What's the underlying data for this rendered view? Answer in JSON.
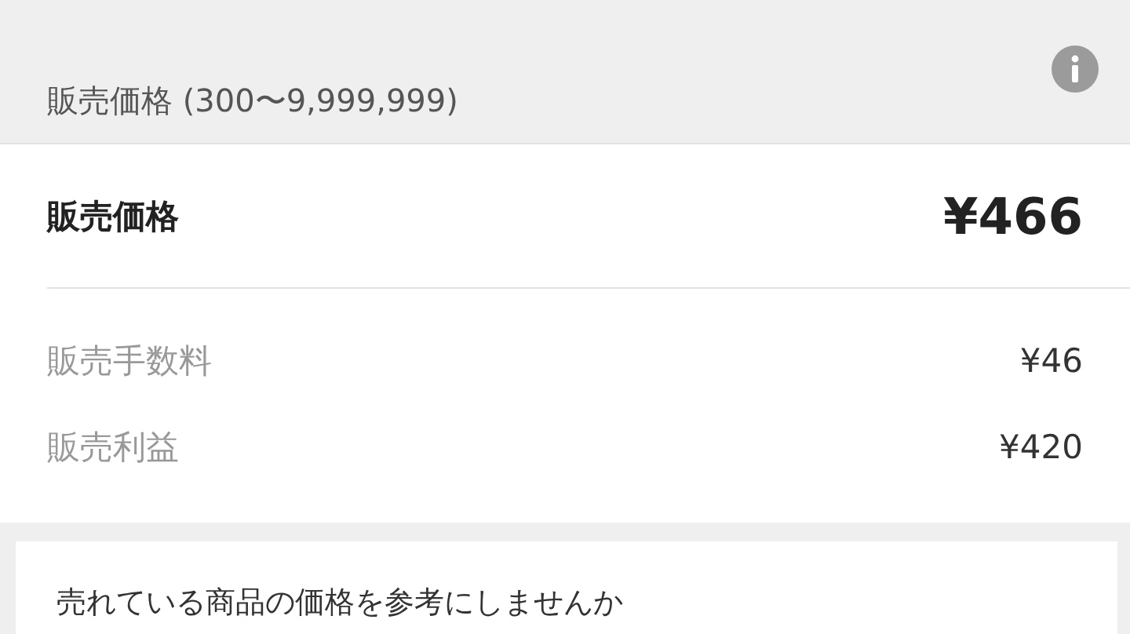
{
  "header": {
    "label": "販売価格 (300〜9,999,999)"
  },
  "price": {
    "label": "販売価格",
    "value": "¥466"
  },
  "details": [
    {
      "label": "販売手数料",
      "value": "¥46"
    },
    {
      "label": "販売利益",
      "value": "¥420"
    }
  ],
  "suggestion": {
    "text": "売れている商品の価格を参考にしませんか"
  }
}
